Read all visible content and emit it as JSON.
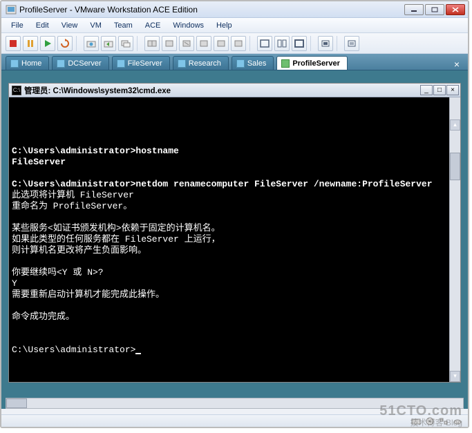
{
  "window": {
    "title": "ProfileServer - VMware Workstation ACE Edition"
  },
  "menu": [
    "File",
    "Edit",
    "View",
    "VM",
    "Team",
    "ACE",
    "Windows",
    "Help"
  ],
  "tabs": {
    "items": [
      {
        "label": "Home"
      },
      {
        "label": "DCServer"
      },
      {
        "label": "FileServer"
      },
      {
        "label": "Research"
      },
      {
        "label": "Sales"
      },
      {
        "label": "ProfileServer"
      }
    ],
    "active_index": 5
  },
  "cmd": {
    "title": "管理员: C:\\Windows\\system32\\cmd.exe",
    "lines": [
      "",
      "C:\\Users\\administrator>hostname",
      "FileServer",
      "",
      "C:\\Users\\administrator>netdom renamecomputer FileServer /newname:ProfileServer",
      "此选项将计算机 FileServer",
      "重命名为 ProfileServer。",
      "",
      "某些服务<如证书颁发机构>依赖于固定的计算机名。",
      "如果此类型的任何服务都在 FileServer 上运行，",
      "则计算机名更改将产生负面影响。",
      "",
      "你要继续吗<Y 或 N>?",
      "Y",
      "需要重新启动计算机才能完成此操作。",
      "",
      "命令成功完成。",
      "",
      "",
      "C:\\Users\\administrator>_"
    ]
  },
  "watermark": {
    "site": "51CTO.com",
    "sub": "技术博客  Blog"
  }
}
